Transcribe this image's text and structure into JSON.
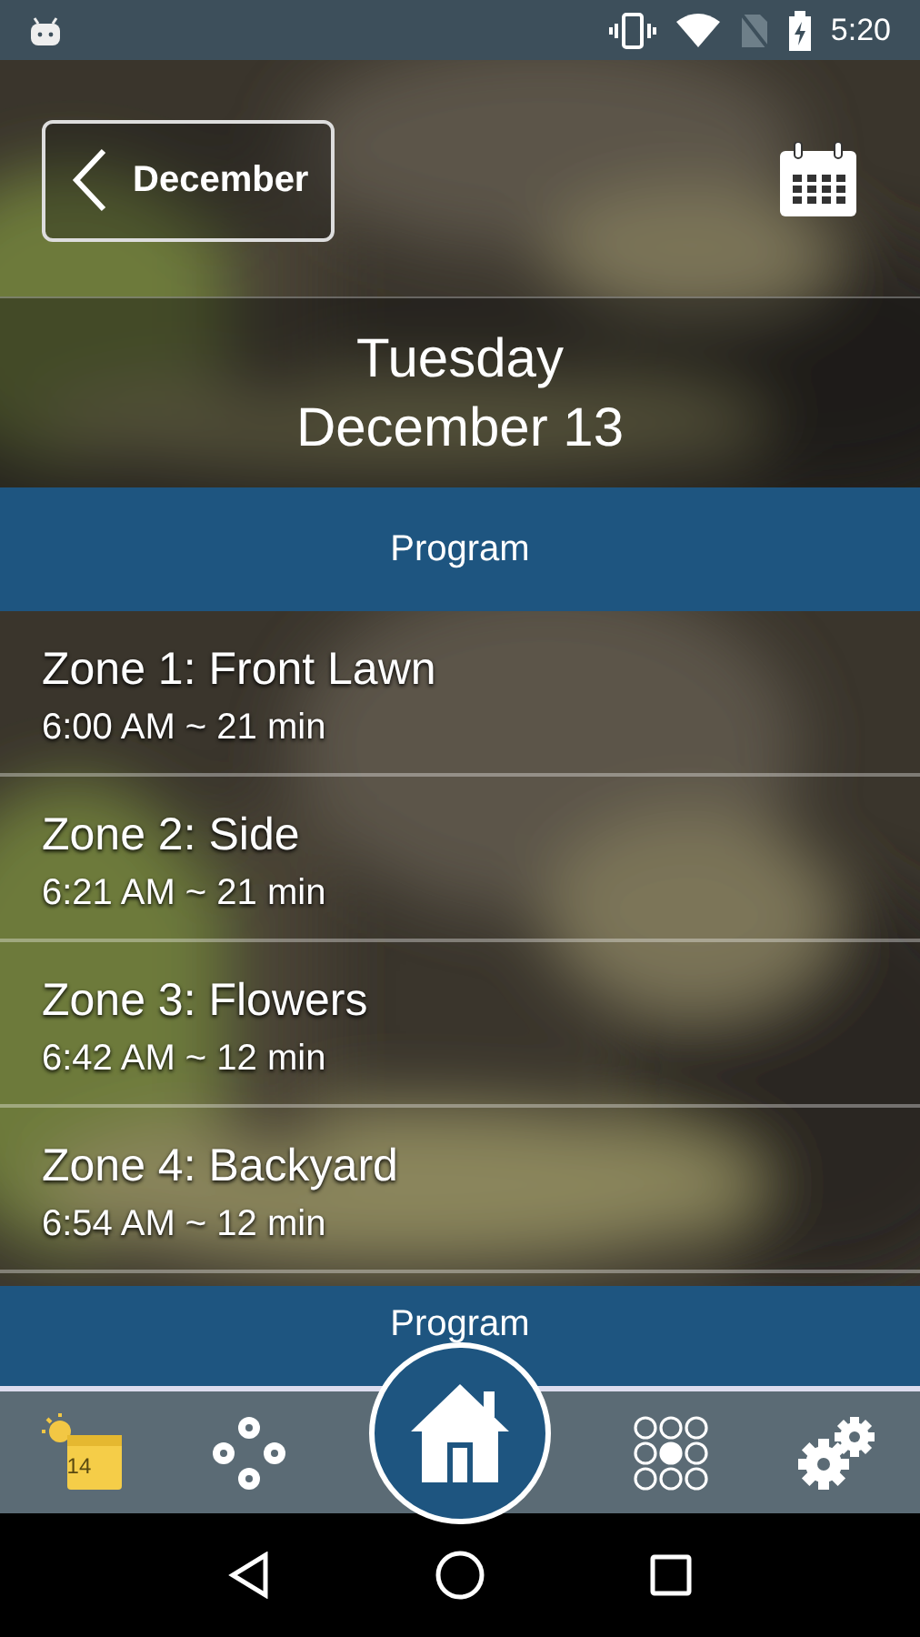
{
  "status_bar": {
    "time": "5:20"
  },
  "header": {
    "back_button": "December",
    "weekday": "Tuesday",
    "date": "December 13"
  },
  "program_header": "Program",
  "zones": [
    {
      "name": "Zone 1: Front Lawn",
      "schedule": "6:00 AM ~ 21 min"
    },
    {
      "name": "Zone 2: Side",
      "schedule": "6:21 AM ~ 21 min"
    },
    {
      "name": "Zone 3: Flowers",
      "schedule": "6:42 AM ~ 12 min"
    },
    {
      "name": "Zone 4: Backyard",
      "schedule": "6:54 AM ~ 12 min"
    }
  ],
  "next_program_header": "Program",
  "bottom_nav": [
    {
      "kind": "calendar",
      "badge": "14",
      "selected": false
    },
    {
      "kind": "zones",
      "selected": false
    },
    {
      "kind": "home",
      "selected": true
    },
    {
      "kind": "grid",
      "selected": false
    },
    {
      "kind": "settings",
      "selected": false
    }
  ]
}
